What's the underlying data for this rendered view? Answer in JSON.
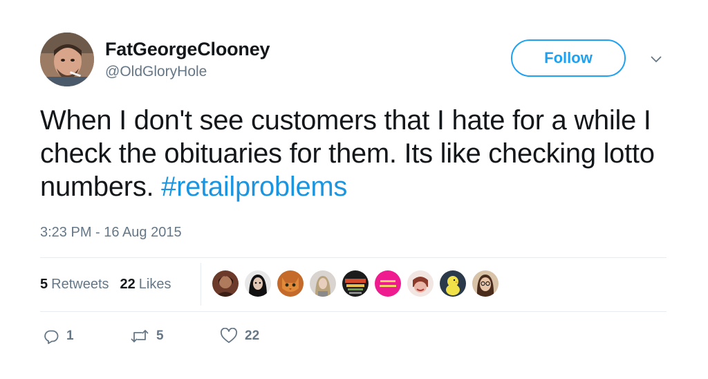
{
  "user": {
    "display_name": "FatGeorgeClooney",
    "handle": "@OldGloryHole",
    "avatar_icon": "profile-photo"
  },
  "follow_label": "Follow",
  "tweet": {
    "text": "When I don't see customers that I hate for a while I check the obituaries for them. Its like checking lotto numbers.",
    "hashtag": "#retailproblems",
    "timestamp": "3:23 PM - 16 Aug 2015"
  },
  "stats": {
    "retweets_count": "5",
    "retweets_label": "Retweets",
    "likes_count": "22",
    "likes_label": "Likes"
  },
  "actions": {
    "reply_count": "1",
    "retweet_count": "5",
    "like_count": "22"
  },
  "colors": {
    "accent": "#1da1f2",
    "hashtag": "#1b95e0",
    "muted_text": "#657786",
    "divider": "#e6ecf0"
  },
  "liker_avatars": [
    "liker-avatar-1",
    "liker-avatar-2",
    "liker-avatar-3",
    "liker-avatar-4",
    "liker-avatar-5",
    "liker-avatar-6",
    "liker-avatar-7",
    "liker-avatar-8",
    "liker-avatar-9"
  ]
}
